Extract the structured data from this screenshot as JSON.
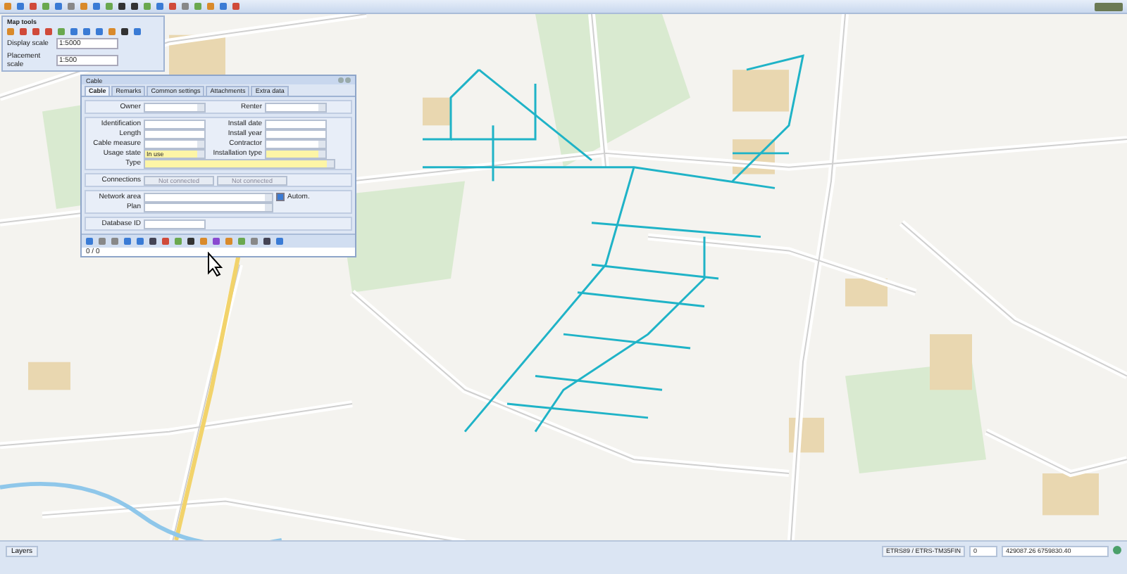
{
  "map_tools": {
    "title": "Map tools",
    "display_scale": {
      "label": "Display scale",
      "value": "1:5000"
    },
    "placement_scale": {
      "label": "Placement scale",
      "value": "1:500"
    }
  },
  "dialog": {
    "title": "Cable",
    "tabs": [
      {
        "label": "Cable",
        "selected": true
      },
      {
        "label": "Remarks",
        "selected": false
      },
      {
        "label": "Common settings",
        "selected": false
      },
      {
        "label": "Attachments",
        "selected": false
      },
      {
        "label": "Extra data",
        "selected": false
      }
    ],
    "owner_row": [
      {
        "label": "Owner",
        "kind": "select",
        "required": false
      },
      {
        "label": "Renter",
        "kind": "select",
        "required": false
      }
    ],
    "detail_rows": [
      [
        {
          "label": "Identification",
          "kind": "text",
          "required": false
        },
        {
          "label": "Install date",
          "kind": "text",
          "required": false
        }
      ],
      [
        {
          "label": "Length",
          "kind": "text",
          "required": false
        },
        {
          "label": "Install year",
          "kind": "text",
          "required": false
        }
      ],
      [
        {
          "label": "Cable measure",
          "kind": "select",
          "required": false
        },
        {
          "label": "Contractor",
          "kind": "select",
          "required": false
        }
      ],
      [
        {
          "label": "Usage state",
          "kind": "select",
          "value": "In use",
          "required": true
        },
        {
          "label": "Installation type",
          "kind": "select",
          "required": true
        }
      ]
    ],
    "type_field": {
      "label": "Type",
      "required": true
    },
    "connections": {
      "label": "Connections",
      "values": [
        "Not connected",
        "Not connected"
      ]
    },
    "network_area": {
      "label": "Network area",
      "checkbox": {
        "label": "Autom.",
        "checked": true
      }
    },
    "plan": {
      "label": "Plan"
    },
    "database_id": {
      "label": "Database ID"
    },
    "status": "0 / 0"
  },
  "status_bar": {
    "layers": "Layers",
    "crs": "ETRS89 / ETRS-TM35FIN",
    "zone": "0",
    "coordinates": "429087.26 6759830.40"
  }
}
